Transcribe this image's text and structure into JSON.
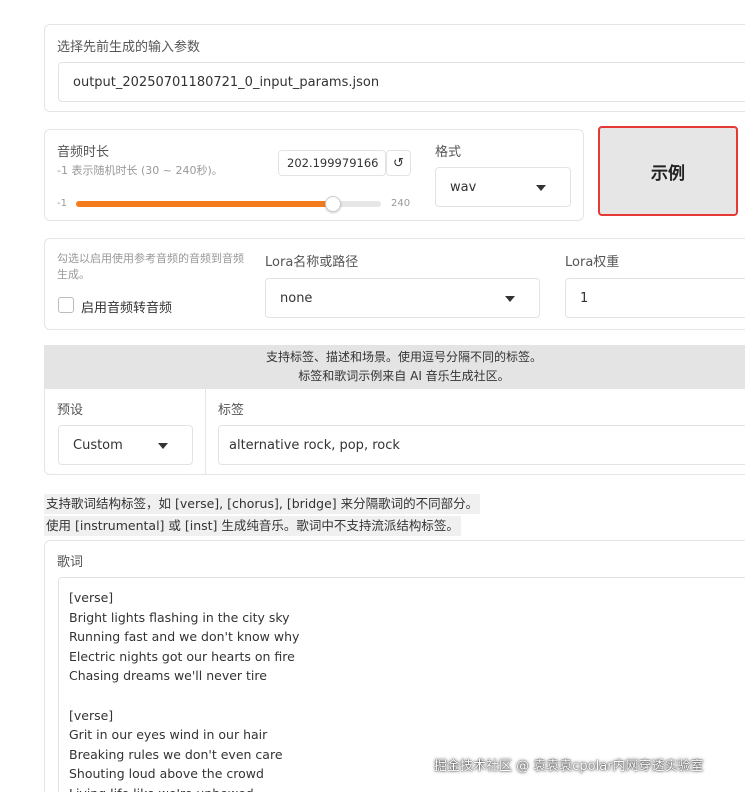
{
  "params_section": {
    "label": "选择先前生成的输入参数",
    "value": "output_20250701180721_0_input_params.json"
  },
  "duration": {
    "label": "音频时长",
    "hint": "-1 表示随机时长 (30 ~ 240秒)。",
    "value": "202.199979166",
    "reset_icon": "↺",
    "slider_min": "-1",
    "slider_max": "240",
    "slider_fraction": 0.843
  },
  "format": {
    "label": "格式",
    "value": "wav"
  },
  "example_button": {
    "label": "示例"
  },
  "reference": {
    "hint": "勾选以启用使用参考音频的音频到音频生成。",
    "checkbox_label": "启用音频转音频"
  },
  "lora": {
    "name_label": "Lora名称或路径",
    "name_value": "none",
    "weight_label": "Lora权重",
    "weight_value": "1"
  },
  "tags_info": {
    "line1": "支持标签、描述和场景。使用逗号分隔不同的标签。",
    "line2": "标签和歌词示例来自 AI 音乐生成社区。"
  },
  "preset": {
    "label": "预设",
    "value": "Custom"
  },
  "tags": {
    "label": "标签",
    "value": "alternative rock, pop, rock"
  },
  "lyrics_info": {
    "line1": "支持歌词结构标签，如 [verse], [chorus], [bridge] 来分隔歌词的不同部分。",
    "line2": "使用 [instrumental] 或 [inst] 生成纯音乐。歌词中不支持流派结构标签。"
  },
  "lyrics": {
    "label": "歌词",
    "lines": [
      "[verse]",
      "Bright lights flashing in the city sky",
      "Running fast and we don't know why",
      "Electric nights got our hearts on fire",
      "Chasing dreams we'll never tire",
      "",
      "[verse]",
      "Grit in our eyes wind in our hair",
      "Breaking rules we don't even care",
      "Shouting loud above the crowd",
      "Living life like we're unbowed"
    ]
  },
  "watermark": "掘金技术社区 @ 袁袁袁cpolar内网穿透实验室",
  "colors": {
    "slider_fill": "#f47c1c",
    "highlight_border": "#e53935"
  }
}
